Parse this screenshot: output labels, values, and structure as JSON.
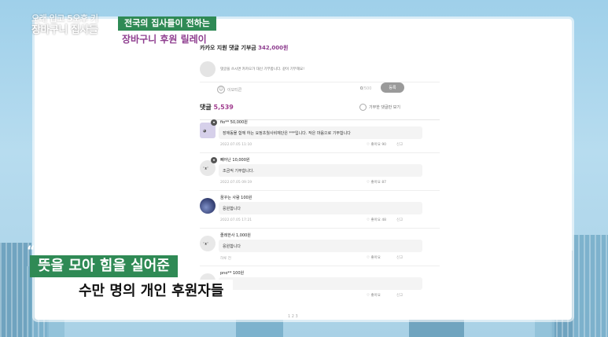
{
  "overlay": {
    "logo_top": "오래 입고 5오후 키",
    "logo_bottom": "장바구니 집사들",
    "header_tag": "전국의 집사들이 전하는",
    "header_title": "장바구니 후원 릴레이",
    "quote_mark": "“",
    "caption_line1": "뜻을 모아 힘을 실어준",
    "caption_line2": "수만 명의 개인 후원자들"
  },
  "donation": {
    "label": "카카오 지원 댓글 기부금",
    "amount": "342,000원"
  },
  "compose": {
    "placeholder": "댓글을 쓰시면 카카오가 대신 기부합니다. 같이 기부해요!",
    "emoji_label": "이모티콘",
    "counter_current": "0",
    "counter_max": "/500",
    "submit_label": "등록"
  },
  "comments_header": {
    "label": "댓글",
    "count": "5,539",
    "my_only_label": "기부한 댓글만 보기"
  },
  "comments": [
    {
      "name": "fio** 50,000원",
      "text": "장애동물 함께 하는 요정초월사비재단은 ***입니다. 작은 마음으로 기부합니다",
      "date": "2022.07.05 11:10",
      "likes": "좋아요 90",
      "report": "신고"
    },
    {
      "name": "빼어난 10,000원",
      "text": "조금씩 기부합니다.",
      "date": "2022.07.05 09:19",
      "likes": "좋아요 87",
      "report": ""
    },
    {
      "name": "꿈꾸는 사람 100원",
      "text": "응원합니다",
      "date": "2022.07.05 17:21",
      "likes": "좋아요 48",
      "report": "신고"
    },
    {
      "name": "졸레한사 1,000원",
      "text": "응원합니다",
      "date": "하루 전",
      "likes": "좋아요",
      "report": "신고"
    },
    {
      "name": "pno** 100원",
      "text": "",
      "date": "",
      "likes": "좋아요",
      "report": "신고"
    }
  ],
  "pager": "1 2 3"
}
